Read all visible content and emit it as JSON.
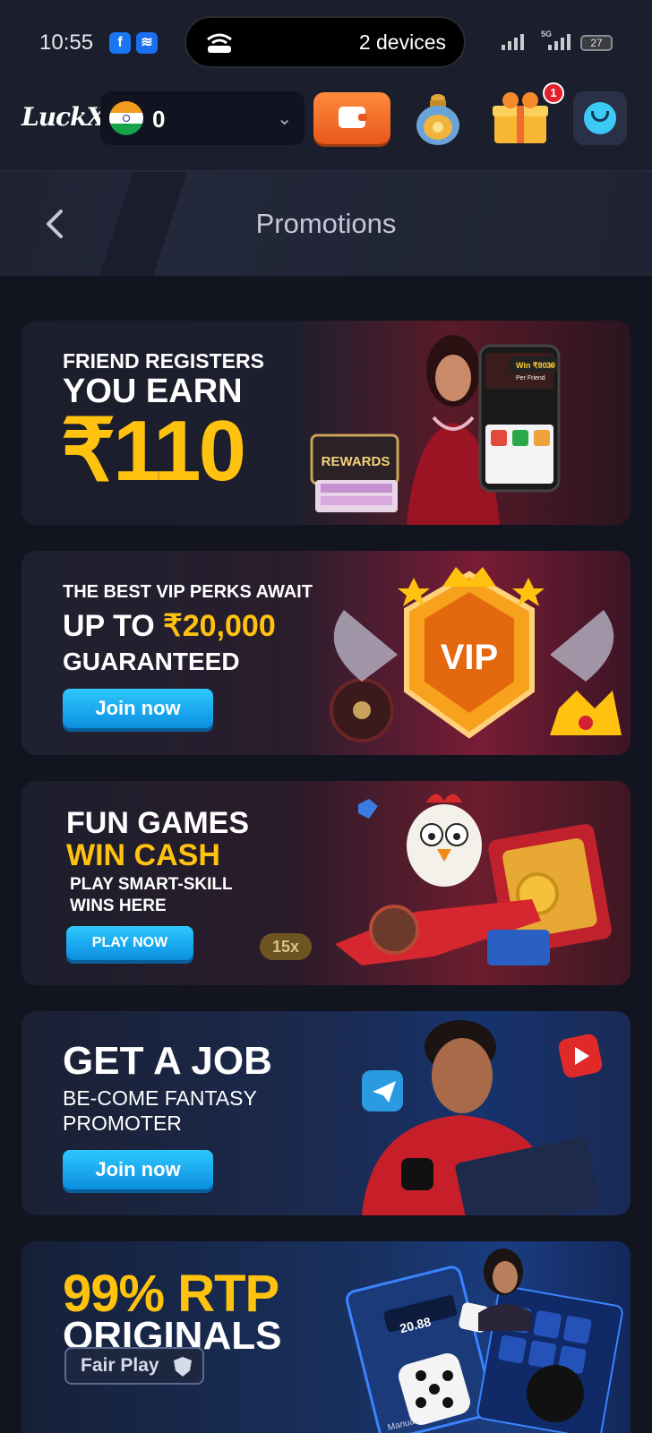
{
  "status_bar": {
    "time": "10:55",
    "hotspot_devices": "2 devices",
    "network": "5G",
    "battery": "27"
  },
  "header": {
    "logo": "LuckX",
    "balance": "0",
    "notification_count": "1"
  },
  "page": {
    "title": "Promotions"
  },
  "banners": [
    {
      "line1": "FRIEND REGISTERS",
      "line2": "YOU EARN",
      "amount": "₹110",
      "chest_label": "REWARDS",
      "phone_text": "Win ₹80 +",
      "phone_sub": "Per Friend",
      "phone_badge": "30"
    },
    {
      "line1": "THE BEST VIP PERKS AWAIT",
      "line2_prefix": "UP TO ",
      "line2_amount": "₹20,000",
      "line3": "GUARANTEED",
      "badge": "VIP",
      "cta": "Join now"
    },
    {
      "line1": "FUN GAMES",
      "line2": "WIN CASH",
      "line3": "PLAY SMART-SKILL",
      "line4": "WINS HERE",
      "cta": "PLAY NOW",
      "multiplier": "15x"
    },
    {
      "line1": "GET A JOB",
      "line2": "BE-COME FANTASY",
      "line3": "PROMOTER",
      "cta": "Join now"
    },
    {
      "line1": "99% RTP",
      "line2": "ORIGINALS",
      "badge": "Fair Play",
      "panel_value": "20.88",
      "panel_label": "Manual"
    }
  ],
  "colors": {
    "accent_yellow": "#ffc20e",
    "cta_blue": "#16a8f0",
    "wallet_orange": "#f26b2a",
    "background": "#121420"
  }
}
